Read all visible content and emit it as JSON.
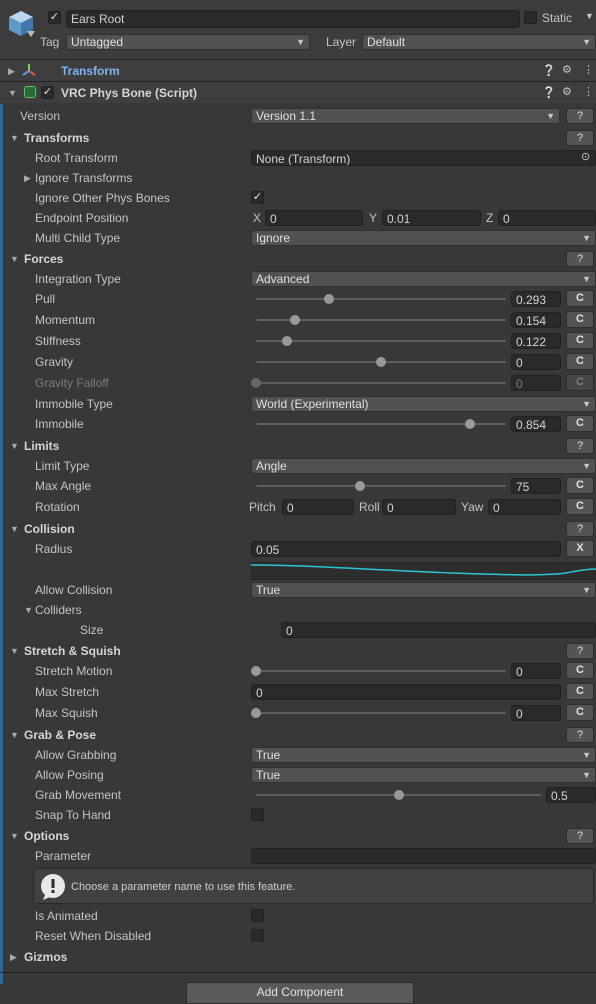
{
  "header": {
    "object_name": "Ears Root",
    "static_label": "Static",
    "tag_label": "Tag",
    "tag_value": "Untagged",
    "layer_label": "Layer",
    "layer_value": "Default"
  },
  "components": {
    "transform_title": "Transform",
    "physbone_title": "VRC Phys Bone (Script)"
  },
  "version": {
    "label": "Version",
    "value": "Version 1.1",
    "help": "?"
  },
  "transforms": {
    "title": "Transforms",
    "root_transform_label": "Root Transform",
    "root_transform_value": "None (Transform)",
    "ignore_transforms_label": "Ignore Transforms",
    "ignore_other_label": "Ignore Other Phys Bones",
    "endpoint_label": "Endpoint Position",
    "endpoint": {
      "x_label": "X",
      "x": "0",
      "y_label": "Y",
      "y": "0.01",
      "z_label": "Z",
      "z": "0"
    },
    "multi_child_label": "Multi Child Type",
    "multi_child_value": "Ignore"
  },
  "forces": {
    "title": "Forces",
    "integration_label": "Integration Type",
    "integration_value": "Advanced",
    "pull_label": "Pull",
    "pull": "0.293",
    "pull_frac": 0.293,
    "momentum_label": "Momentum",
    "momentum": "0.154",
    "momentum_frac": 0.154,
    "stiffness_label": "Stiffness",
    "stiffness": "0.122",
    "stiffness_frac": 0.122,
    "gravity_label": "Gravity",
    "gravity": "0",
    "gravity_frac": 0.5,
    "gravity_falloff_label": "Gravity Falloff",
    "gravity_falloff": "0",
    "gravity_falloff_frac": 0,
    "immobile_type_label": "Immobile Type",
    "immobile_type_value": "World (Experimental)",
    "immobile_label": "Immobile",
    "immobile": "0.854",
    "immobile_frac": 0.854
  },
  "limits": {
    "title": "Limits",
    "limit_type_label": "Limit Type",
    "limit_type_value": "Angle",
    "max_angle_label": "Max Angle",
    "max_angle": "75",
    "max_angle_frac": 0.4167,
    "rotation_label": "Rotation",
    "pitch_label": "Pitch",
    "pitch": "0",
    "roll_label": "Roll",
    "roll": "0",
    "yaw_label": "Yaw",
    "yaw": "0"
  },
  "collision": {
    "title": "Collision",
    "radius_label": "Radius",
    "radius": "0.05",
    "radius_btn": "X",
    "allow_collision_label": "Allow Collision",
    "allow_collision_value": "True",
    "colliders_label": "Colliders",
    "size_label": "Size",
    "size": "0"
  },
  "stretch": {
    "title": "Stretch & Squish",
    "stretch_motion_label": "Stretch Motion",
    "stretch_motion": "0",
    "stretch_motion_frac": 0,
    "max_stretch_label": "Max Stretch",
    "max_stretch": "0",
    "max_squish_label": "Max Squish",
    "max_squish": "0",
    "max_squish_frac": 0
  },
  "grab": {
    "title": "Grab & Pose",
    "allow_grabbing_label": "Allow Grabbing",
    "allow_grabbing_value": "True",
    "allow_posing_label": "Allow Posing",
    "allow_posing_value": "True",
    "grab_movement_label": "Grab Movement",
    "grab_movement": "0.5",
    "grab_movement_frac": 0.5,
    "snap_label": "Snap To Hand"
  },
  "options": {
    "title": "Options",
    "parameter_label": "Parameter",
    "help_text": "Choose a parameter name to use this feature.",
    "is_animated_label": "Is Animated",
    "reset_label": "Reset When Disabled"
  },
  "gizmos": {
    "title": "Gizmos"
  },
  "buttons": {
    "c": "C",
    "help": "?",
    "add_component": "Add Component"
  },
  "colors": {
    "accent": "#2d6a9b",
    "curve": "#2cc7d6",
    "link": "#7fb3ef"
  },
  "icons": [
    "gameobject-cube-icon",
    "transform-axes-icon",
    "script-icon",
    "help-icon",
    "settings-sliders-icon",
    "kebab-menu-icon",
    "object-picker-icon",
    "info-icon"
  ]
}
